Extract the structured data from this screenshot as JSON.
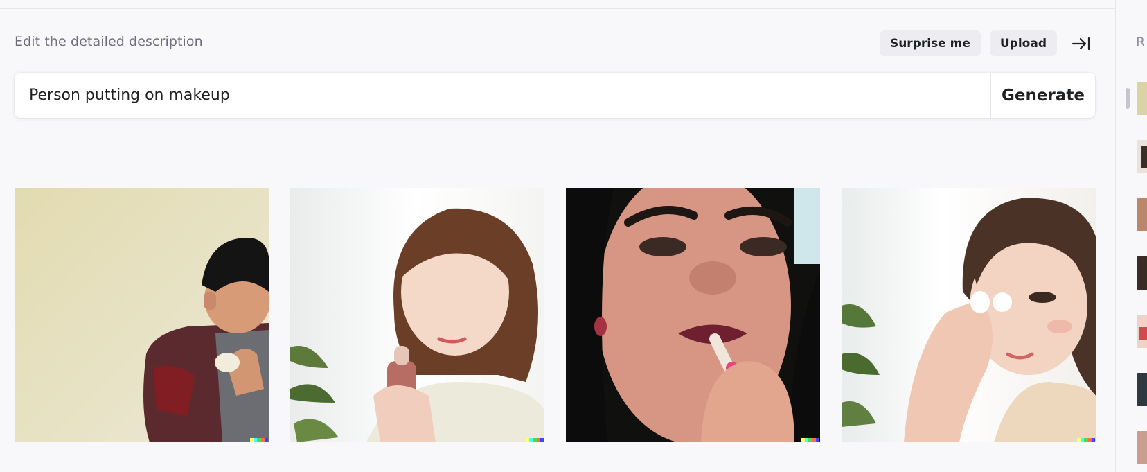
{
  "header": {
    "label": "Edit the detailed description",
    "surprise_label": "Surprise me",
    "upload_label": "Upload",
    "collapse_icon": "arrow-right-bar-icon"
  },
  "prompt": {
    "value": "Person putting on makeup",
    "generate_label": "Generate"
  },
  "results": [
    {
      "alt": "man applying makeup with sponge"
    },
    {
      "alt": "woman with lip gloss"
    },
    {
      "alt": "woman applying lipstick close-up"
    },
    {
      "alt": "woman applying makeup to eye"
    }
  ],
  "signature_colors": [
    "#ffff66",
    "#42ffff",
    "#51da4c",
    "#ff6e3c",
    "#3c46ff"
  ],
  "sidebar": {
    "heading_letter": "R",
    "thumbnail_count": 8
  }
}
